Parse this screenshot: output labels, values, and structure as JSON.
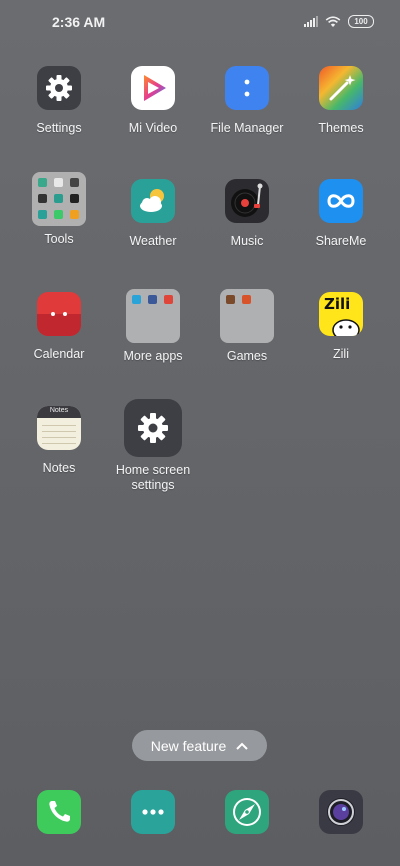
{
  "status_bar": {
    "time": "2:36 AM",
    "battery": "100"
  },
  "apps": [
    {
      "label": "Settings"
    },
    {
      "label": "Mi Video"
    },
    {
      "label": "File Manager"
    },
    {
      "label": "Themes"
    },
    {
      "label": "Tools"
    },
    {
      "label": "Weather"
    },
    {
      "label": "Music"
    },
    {
      "label": "ShareMe"
    },
    {
      "label": "Calendar"
    },
    {
      "label": "More apps"
    },
    {
      "label": "Games"
    },
    {
      "label": "Zili"
    },
    {
      "label": "Notes"
    },
    {
      "label": "Home screen settings"
    }
  ],
  "icon_text": {
    "zili": "Zili",
    "notes": "Notes"
  },
  "new_feature": {
    "label": "New feature"
  },
  "dock": [
    {
      "icon": "phone-icon"
    },
    {
      "icon": "messaging-icon"
    },
    {
      "icon": "browser-icon"
    },
    {
      "icon": "camera-icon"
    }
  ],
  "colors": {
    "wallpaper": "#65676b",
    "settings_bg": "#3d3f44",
    "file_manager_bg": "#3f83f0",
    "weather_bg": "#2aa198",
    "shareme_bg": "#1e90f0",
    "calendar_bg": "#e03a3a",
    "phone_bg": "#3ecb5c",
    "messaging_bg": "#2aa39a",
    "browser_bg": "#2ea57c",
    "camera_bg": "#3a3a44"
  }
}
